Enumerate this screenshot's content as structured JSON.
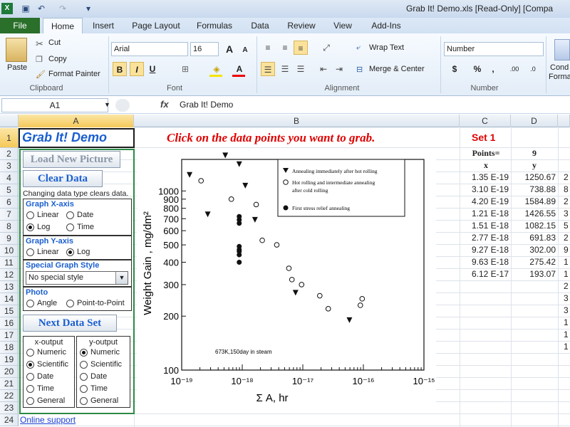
{
  "window": {
    "title": "Grab It! Demo.xls  [Read-Only]  [Compa"
  },
  "tabs": [
    "File",
    "Home",
    "Insert",
    "Page Layout",
    "Formulas",
    "Data",
    "Review",
    "View",
    "Add-Ins"
  ],
  "ribbon": {
    "clipboard": {
      "paste": "Paste",
      "cut": "Cut",
      "copy": "Copy",
      "format_painter": "Format Painter",
      "label": "Clipboard"
    },
    "font": {
      "name": "Arial",
      "size": "16",
      "label": "Font",
      "bold": "B",
      "italic": "I",
      "underline": "U",
      "grow": "A",
      "shrink": "A"
    },
    "alignment": {
      "wrap": "Wrap Text",
      "merge": "Merge & Center",
      "label": "Alignment"
    },
    "number": {
      "format": "Number",
      "currency": "$",
      "percent": "%",
      "comma": ",",
      "inc": ".00",
      "dec": ".0",
      "label": "Number"
    },
    "styles": {
      "cond": "Cond",
      "format": "Forma"
    }
  },
  "formula_bar": {
    "cell": "A1",
    "fx": "fx",
    "content": "Grab It! Demo"
  },
  "columns": [
    "A",
    "B",
    "C",
    "D"
  ],
  "rows": [
    "1",
    "2",
    "3",
    "4",
    "5",
    "6",
    "7",
    "8",
    "9",
    "10",
    "11",
    "12",
    "13",
    "14",
    "15",
    "16",
    "17",
    "18",
    "19",
    "20",
    "21",
    "22",
    "23",
    "24"
  ],
  "sheet": {
    "a1": "Grab It! Demo",
    "b1": "Click on the data points you want to grab.",
    "load_button": "Load New Picture",
    "clear_button": "Clear Data",
    "change_note": "Changing  data type clears data.",
    "xaxis": {
      "title": "Graph X-axis",
      "linear": "Linear",
      "date": "Date",
      "log": "Log",
      "time": "Time"
    },
    "yaxis": {
      "title": "Graph Y-axis",
      "linear": "Linear",
      "log": "Log"
    },
    "special": {
      "title": "Special Graph Style",
      "value": "No special style"
    },
    "photo": {
      "title": "Photo",
      "angle": "Angle",
      "p2p": "Point-to-Point"
    },
    "next_button": "Next Data Set",
    "xout": {
      "title": "x-output",
      "opts": [
        "Numeric",
        "Scientific",
        "Date",
        "Time",
        "General"
      ]
    },
    "yout": {
      "title": "y-output",
      "opts": [
        "Numeric",
        "Scientific",
        "Date",
        "Time",
        "General"
      ]
    },
    "online": "Online support",
    "set_title": "Set 1",
    "points_label": "Points=",
    "points_count": "9",
    "x_header": "x",
    "y_header": "y",
    "x_values": [
      "1.35 E-19",
      "3.10 E-19",
      "4.20 E-19",
      "1.21 E-18",
      "1.51 E-18",
      "2.77 E-18",
      "9.27 E-18",
      "9.63 E-18",
      "6.12 E-17"
    ],
    "y_values": [
      "1250.67",
      "738.88",
      "1584.89",
      "1426.55",
      "1082.15",
      "691.83",
      "302.00",
      "275.42",
      "193.07"
    ],
    "e_values": [
      "2",
      "8",
      "2",
      "3",
      "5",
      "2",
      "9",
      "1",
      "1",
      "2",
      "3",
      "3",
      "1",
      "1",
      "1"
    ]
  },
  "chart_data": {
    "type": "scatter",
    "xlabel": "Σ A, hr",
    "ylabel": "Weight Gain , mg/dm²",
    "x_ticks": [
      "10⁻¹⁹",
      "10⁻¹⁸",
      "10⁻¹⁷",
      "10⁻¹⁶",
      "10⁻¹⁵"
    ],
    "y_ticks": [
      "100",
      "200",
      "300",
      "400",
      "500",
      "600",
      "700",
      "800",
      "900",
      "1000"
    ],
    "xlim": [
      -19,
      -15
    ],
    "ylim": [
      100,
      1500
    ],
    "x_log": true,
    "y_log": true,
    "legend": [
      {
        "symbol": "triangle",
        "text": "Annealing immediately after hot rolling"
      },
      {
        "symbol": "open-circle",
        "text": "Hot rolling and intermediate annealing after cold rolling"
      },
      {
        "symbol": "filled-circle",
        "text": "First stress relief annealing"
      }
    ],
    "annotation": "673K,150day in steam",
    "series": [
      {
        "symbol": "triangle",
        "x": [
          -18.87,
          -18.57,
          -18.28,
          -18.05,
          -17.95,
          -17.79,
          -17.12,
          -16.23
        ],
        "y": [
          1230,
          740,
          1580,
          1410,
          1070,
          690,
          270,
          190
        ]
      },
      {
        "symbol": "open-circle",
        "x": [
          -18.68,
          -18.18,
          -17.77,
          -17.67,
          -17.43,
          -17.23,
          -17.18,
          -17.02,
          -16.72,
          -16.58,
          -16.05,
          -16.02
        ],
        "y": [
          1140,
          900,
          840,
          530,
          500,
          370,
          320,
          300,
          260,
          220,
          230,
          250
        ]
      },
      {
        "symbol": "filled-circle",
        "x": [
          -18.05,
          -18.05,
          -18.05,
          -18.05,
          -18.05,
          -18.05,
          -18.05,
          -18.05
        ],
        "y": [
          720,
          690,
          660,
          490,
          470,
          440,
          400,
          460
        ]
      }
    ]
  }
}
